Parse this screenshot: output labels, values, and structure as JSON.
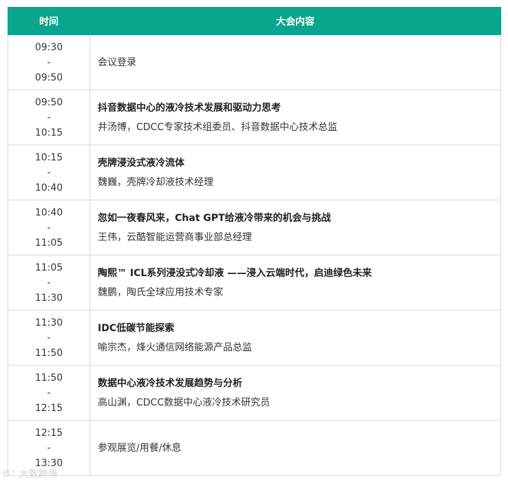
{
  "header": {
    "time_label": "时间",
    "content_label": "大会内容"
  },
  "rows": [
    {
      "start": "09:30",
      "sep": "-",
      "end": "09:50",
      "title": "",
      "speaker": "",
      "plain": "会议登录"
    },
    {
      "start": "09:50",
      "sep": "-",
      "end": "10:15",
      "title": "抖音数据中心的液冷技术发展和驱动力思考",
      "speaker": "井汤博，CDCC专家技术组委员、抖音数据中心技术总监",
      "plain": ""
    },
    {
      "start": "10:15",
      "sep": "-",
      "end": "10:40",
      "title": "壳牌浸没式液冷流体",
      "speaker": "魏巍，壳牌冷却液技术经理",
      "plain": ""
    },
    {
      "start": "10:40",
      "sep": "-",
      "end": "11:05",
      "title": "忽如一夜春风来，Chat GPT给液冷带来的机会与挑战",
      "speaker": "王伟，云酷智能运营商事业部总经理",
      "plain": ""
    },
    {
      "start": "11:05",
      "sep": "-",
      "end": "11:30",
      "title": "陶熙™ ICL系列浸没式冷却液 ——浸入云端时代，启迪绿色未来",
      "speaker": "魏鹏，陶氏全球应用技术专家",
      "plain": ""
    },
    {
      "start": "11:30",
      "sep": "-",
      "end": "11:50",
      "title": "IDC低碳节能探索",
      "speaker": "喻宗杰，烽火通信网络能源产品总监",
      "plain": ""
    },
    {
      "start": "11:50",
      "sep": "-",
      "end": "12:15",
      "title": "数据中心液冷技术发展趋势与分析",
      "speaker": "高山渊，CDCC数据中心液冷技术研究员",
      "plain": ""
    },
    {
      "start": "12:15",
      "sep": "-",
      "end": "13:30",
      "title": "",
      "speaker": "",
      "plain": "参观展览/用餐/休息"
    }
  ],
  "watermark": "©° 大数跨境"
}
